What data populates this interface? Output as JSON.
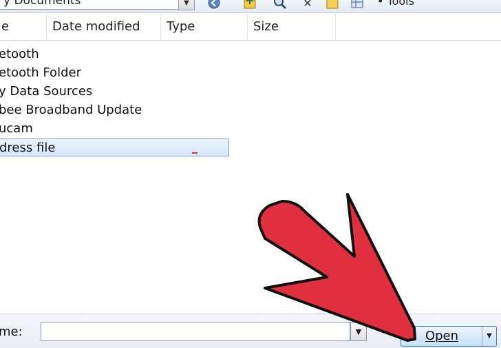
{
  "toolbar": {
    "look_in_value": "y Documents",
    "tools_label": "• Tools",
    "icons": [
      "back-icon",
      "up-folder-icon",
      "search-web-icon",
      "delete-icon",
      "new-folder-icon",
      "views-icon"
    ]
  },
  "columns": {
    "name": "e",
    "date_modified": "Date modified",
    "type": "Type",
    "size": "Size"
  },
  "files": [
    {
      "name": "etooth"
    },
    {
      "name": "etooth Folder"
    },
    {
      "name": "y Data Sources"
    },
    {
      "name": "bee Broadband Update"
    },
    {
      "name": "ucam"
    },
    {
      "name": "dress file",
      "selected": true
    }
  ],
  "bottom": {
    "file_name_label": "me:",
    "file_name_value": "",
    "open_label": "Open"
  },
  "colors": {
    "arrow_fill": "#e03040",
    "arrow_stroke": "#111111",
    "selection": "#d6e8fb",
    "open_border": "#3c7fb1"
  }
}
